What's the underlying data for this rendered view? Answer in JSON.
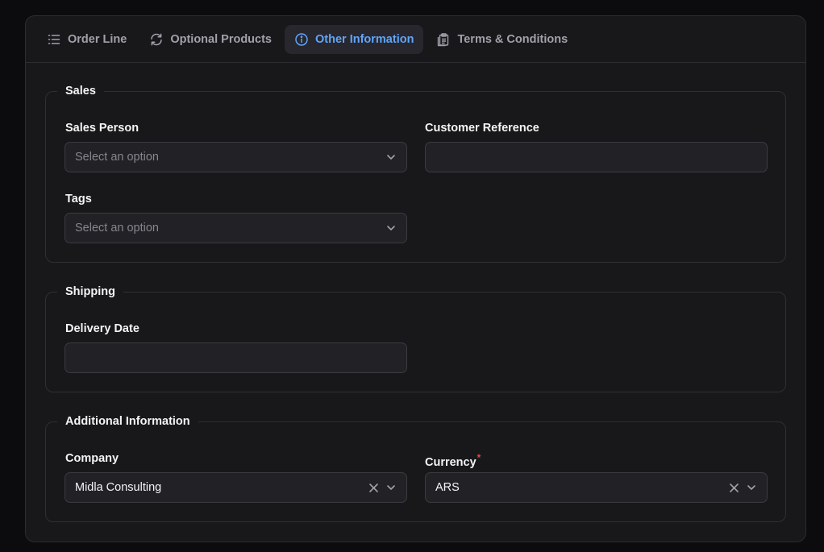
{
  "tabs": [
    {
      "label": "Order Line",
      "icon": "list-icon"
    },
    {
      "label": "Optional Products",
      "icon": "refresh-icon"
    },
    {
      "label": "Other Information",
      "icon": "info-icon",
      "active": true
    },
    {
      "label": "Terms & Conditions",
      "icon": "clipboard-icon"
    }
  ],
  "sections": {
    "sales": {
      "title": "Sales",
      "sales_person": {
        "label": "Sales Person",
        "placeholder": "Select an option"
      },
      "customer_reference": {
        "label": "Customer Reference",
        "value": ""
      },
      "tags": {
        "label": "Tags",
        "placeholder": "Select an option"
      }
    },
    "shipping": {
      "title": "Shipping",
      "delivery_date": {
        "label": "Delivery Date",
        "value": ""
      }
    },
    "additional": {
      "title": "Additional Information",
      "company": {
        "label": "Company",
        "value": "Midla Consulting"
      },
      "currency": {
        "label": "Currency",
        "required_marker": "*",
        "value": "ARS"
      }
    }
  },
  "colors": {
    "accent": "#60a5fa",
    "background": "#18181b",
    "required": "#ef4444"
  }
}
